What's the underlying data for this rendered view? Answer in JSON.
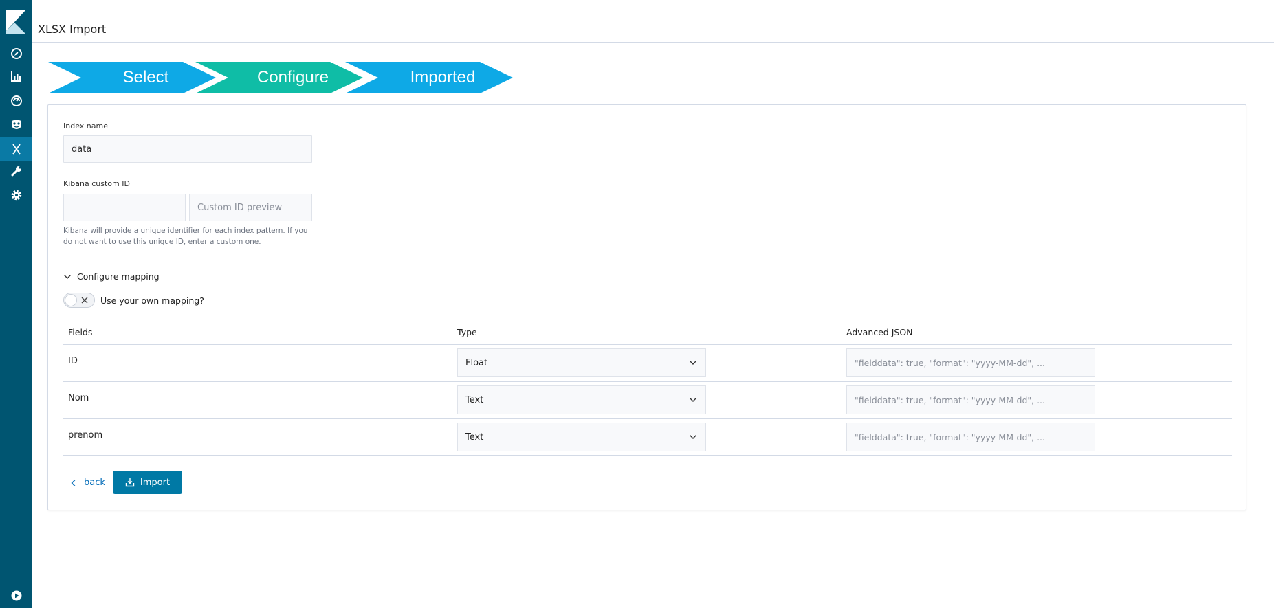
{
  "header": {
    "title": "XLSX Import"
  },
  "sidebar": {
    "items": [
      {
        "icon": "compass-icon"
      },
      {
        "icon": "bar-chart-icon"
      },
      {
        "icon": "dashboard-icon"
      },
      {
        "icon": "mask-icon"
      },
      {
        "icon": "x-icon",
        "active": true
      },
      {
        "icon": "wrench-icon"
      },
      {
        "icon": "gear-icon"
      }
    ],
    "footer_icon": "play-icon"
  },
  "steps": [
    {
      "label": "Select",
      "color": "#0ea9e6"
    },
    {
      "label": "Configure",
      "color": "#0fbda6"
    },
    {
      "label": "Imported",
      "color": "#0ea9e6"
    }
  ],
  "form": {
    "index_name_label": "Index name",
    "index_name_value": "data",
    "custom_id_label": "Kibana custom ID",
    "custom_id_value": "",
    "custom_id_preview_placeholder": "Custom ID preview",
    "help_text": "Kibana will provide a unique identifier for each index pattern. If you do not want to use this unique ID, enter a custom one."
  },
  "mapping": {
    "accordion_label": "Configure mapping",
    "switch_label": "Use your own mapping?",
    "switch_on": false,
    "columns": [
      "Fields",
      "Type",
      "Advanced JSON"
    ],
    "rows": [
      {
        "field": "ID",
        "type": "Float",
        "json_placeholder": "\"fielddata\": true, \"format\": \"yyyy-MM-dd\", ..."
      },
      {
        "field": "Nom",
        "type": "Text",
        "json_placeholder": "\"fielddata\": true, \"format\": \"yyyy-MM-dd\", ..."
      },
      {
        "field": "prenom",
        "type": "Text",
        "json_placeholder": "\"fielddata\": true, \"format\": \"yyyy-MM-dd\", ..."
      }
    ]
  },
  "actions": {
    "back_label": "back",
    "import_label": "Import"
  },
  "colors": {
    "sidebar": "#005571",
    "sidebar_active": "#0a7aa5",
    "primary_button": "#0079a5",
    "link": "#006bb8"
  }
}
